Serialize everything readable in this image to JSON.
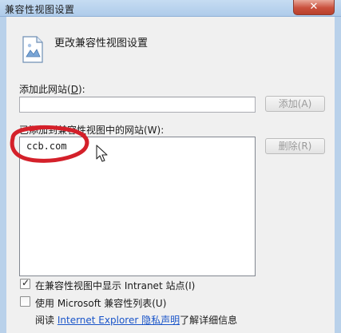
{
  "window": {
    "title": "兼容性视图设置",
    "close_glyph": "✕"
  },
  "header": {
    "title": "更改兼容性视图设置",
    "icon": "compatibility-page-icon"
  },
  "add_site": {
    "label": "添加此网站",
    "shortcut_open": "(",
    "shortcut_key": "D",
    "shortcut_close": "):",
    "input_value": "",
    "button_label": "添加(A)"
  },
  "site_list": {
    "label": "已添加到兼容性视图中的网站(W):",
    "items": [
      "ccb.com"
    ],
    "remove_button_label": "删除(R)"
  },
  "options": {
    "show_intranet": {
      "label": "在兼容性视图中显示 Intranet 站点(I)",
      "checked": true,
      "check_glyph": "✓"
    },
    "use_ms_list": {
      "label": "使用 Microsoft 兼容性列表(U)",
      "checked": false
    }
  },
  "footer": {
    "prefix": "阅读",
    "link_text": "Internet Explorer 隐私声明",
    "suffix": "了解详细信息"
  },
  "colors": {
    "annotation_red": "#d4202a",
    "link_blue": "#1a55c9"
  }
}
